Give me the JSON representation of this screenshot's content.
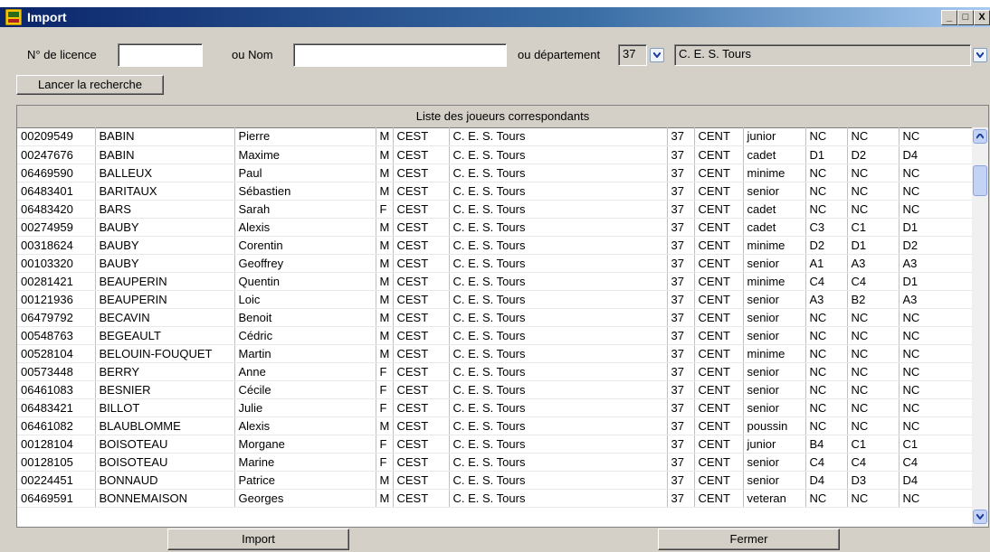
{
  "window": {
    "title": "Import",
    "controls": [
      "_",
      "□",
      "X"
    ]
  },
  "search": {
    "licence_label": "N° de licence",
    "licence_value": "",
    "nom_label": "ou Nom",
    "nom_value": "",
    "departement_label": "ou département",
    "departement_value": "37",
    "club_value": "C. E. S. Tours",
    "search_button": "Lancer la recherche"
  },
  "list": {
    "header": "Liste des joueurs correspondants",
    "rows": [
      [
        "00209549",
        "BABIN",
        "Pierre",
        "M",
        "CEST",
        "C. E. S. Tours",
        "37",
        "CENT",
        "junior",
        "NC",
        "NC",
        "NC"
      ],
      [
        "00247676",
        "BABIN",
        "Maxime",
        "M",
        "CEST",
        "C. E. S. Tours",
        "37",
        "CENT",
        "cadet",
        "D1",
        "D2",
        "D4"
      ],
      [
        "06469590",
        "BALLEUX",
        "Paul",
        "M",
        "CEST",
        "C. E. S. Tours",
        "37",
        "CENT",
        "minime",
        "NC",
        "NC",
        "NC"
      ],
      [
        "06483401",
        "BARITAUX",
        "Sébastien",
        "M",
        "CEST",
        "C. E. S. Tours",
        "37",
        "CENT",
        "senior",
        "NC",
        "NC",
        "NC"
      ],
      [
        "06483420",
        "BARS",
        "Sarah",
        "F",
        "CEST",
        "C. E. S. Tours",
        "37",
        "CENT",
        "cadet",
        "NC",
        "NC",
        "NC"
      ],
      [
        "00274959",
        "BAUBY",
        "Alexis",
        "M",
        "CEST",
        "C. E. S. Tours",
        "37",
        "CENT",
        "cadet",
        "C3",
        "C1",
        "D1"
      ],
      [
        "00318624",
        "BAUBY",
        "Corentin",
        "M",
        "CEST",
        "C. E. S. Tours",
        "37",
        "CENT",
        "minime",
        "D2",
        "D1",
        "D2"
      ],
      [
        "00103320",
        "BAUBY",
        "Geoffrey",
        "M",
        "CEST",
        "C. E. S. Tours",
        "37",
        "CENT",
        "senior",
        "A1",
        "A3",
        "A3"
      ],
      [
        "00281421",
        "BEAUPERIN",
        "Quentin",
        "M",
        "CEST",
        "C. E. S. Tours",
        "37",
        "CENT",
        "minime",
        "C4",
        "C4",
        "D1"
      ],
      [
        "00121936",
        "BEAUPERIN",
        "Loic",
        "M",
        "CEST",
        "C. E. S. Tours",
        "37",
        "CENT",
        "senior",
        "A3",
        "B2",
        "A3"
      ],
      [
        "06479792",
        "BECAVIN",
        "Benoit",
        "M",
        "CEST",
        "C. E. S. Tours",
        "37",
        "CENT",
        "senior",
        "NC",
        "NC",
        "NC"
      ],
      [
        "00548763",
        "BEGEAULT",
        "Cédric",
        "M",
        "CEST",
        "C. E. S. Tours",
        "37",
        "CENT",
        "senior",
        "NC",
        "NC",
        "NC"
      ],
      [
        "00528104",
        "BELOUIN-FOUQUET",
        "Martin",
        "M",
        "CEST",
        "C. E. S. Tours",
        "37",
        "CENT",
        "minime",
        "NC",
        "NC",
        "NC"
      ],
      [
        "00573448",
        "BERRY",
        "Anne",
        "F",
        "CEST",
        "C. E. S. Tours",
        "37",
        "CENT",
        "senior",
        "NC",
        "NC",
        "NC"
      ],
      [
        "06461083",
        "BESNIER",
        "Cécile",
        "F",
        "CEST",
        "C. E. S. Tours",
        "37",
        "CENT",
        "senior",
        "NC",
        "NC",
        "NC"
      ],
      [
        "06483421",
        "BILLOT",
        "Julie",
        "F",
        "CEST",
        "C. E. S. Tours",
        "37",
        "CENT",
        "senior",
        "NC",
        "NC",
        "NC"
      ],
      [
        "06461082",
        "BLAUBLOMME",
        "Alexis",
        "M",
        "CEST",
        "C. E. S. Tours",
        "37",
        "CENT",
        "poussin",
        "NC",
        "NC",
        "NC"
      ],
      [
        "00128104",
        "BOISOTEAU",
        "Morgane",
        "F",
        "CEST",
        "C. E. S. Tours",
        "37",
        "CENT",
        "junior",
        "B4",
        "C1",
        "C1"
      ],
      [
        "00128105",
        "BOISOTEAU",
        "Marine",
        "F",
        "CEST",
        "C. E. S. Tours",
        "37",
        "CENT",
        "senior",
        "C4",
        "C4",
        "C4"
      ],
      [
        "00224451",
        "BONNAUD",
        "Patrice",
        "M",
        "CEST",
        "C. E. S. Tours",
        "37",
        "CENT",
        "senior",
        "D4",
        "D3",
        "D4"
      ],
      [
        "06469591",
        "BONNEMAISON",
        "Georges",
        "M",
        "CEST",
        "C. E. S. Tours",
        "37",
        "CENT",
        "veteran",
        "NC",
        "NC",
        "NC"
      ]
    ]
  },
  "footer": {
    "import_button": "Import",
    "close_button": "Fermer"
  },
  "colors": {
    "title_start": "#0a246a",
    "title_end": "#a6caf0",
    "face": "#d4d0c8"
  }
}
